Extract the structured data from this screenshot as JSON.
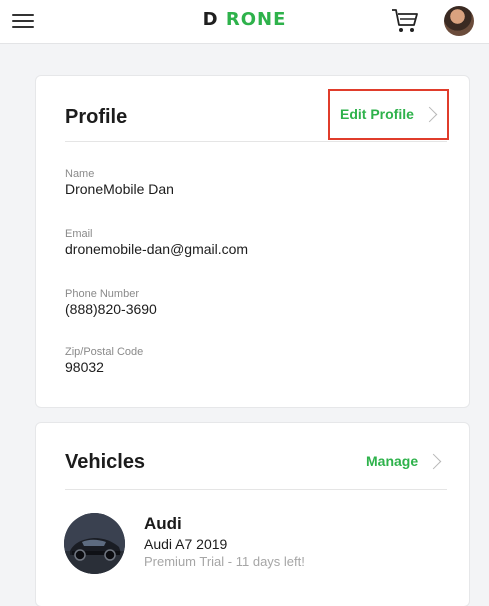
{
  "header": {
    "logo": "DRONE",
    "menu_icon": "hamburger-menu-icon",
    "cart_icon": "shopping-cart-icon",
    "avatar_icon": "user-avatar"
  },
  "colors": {
    "brand_green": "#2eb24b",
    "highlight_red": "#e03c2b",
    "background": "#f3f4f6"
  },
  "profile": {
    "title": "Profile",
    "edit_label": "Edit Profile",
    "fields": [
      {
        "label": "Name",
        "value": "DroneMobile Dan"
      },
      {
        "label": "Email",
        "value": "dronemobile-dan@gmail.com"
      },
      {
        "label": "Phone Number",
        "value": "(888)820-3690"
      },
      {
        "label": "Zip/Postal Code",
        "value": "98032"
      }
    ]
  },
  "vehicles": {
    "title": "Vehicles",
    "manage_label": "Manage",
    "items": [
      {
        "name": "Audi",
        "model": "Audi A7 2019",
        "status": "Premium Trial - 11 days left!"
      }
    ]
  }
}
